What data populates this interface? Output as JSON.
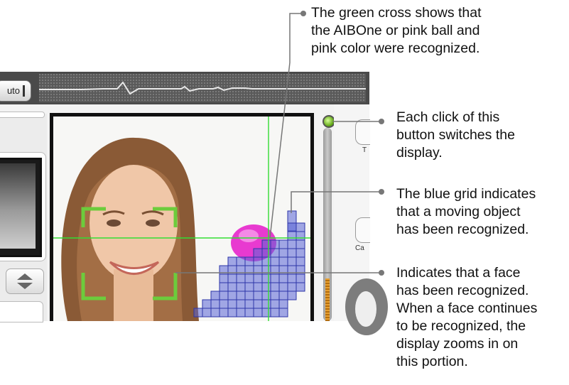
{
  "toolbar": {
    "auto_label": "uto"
  },
  "right_panel": {
    "tab_top_label": "T",
    "tab_mid_label": "Ca"
  },
  "annotations": {
    "green_cross": [
      "The green cross shows that",
      "the AIBOne or pink ball and",
      "pink color were recognized."
    ],
    "display_button": [
      "Each click of this",
      "button switches the",
      "display."
    ],
    "blue_grid": [
      "The blue grid indicates",
      "that a moving object",
      "has been recognized."
    ],
    "face": [
      "Indicates that a face",
      "has been recognized.",
      "When a face continues",
      "to be recognized, the",
      "display zooms in on",
      "this portion."
    ]
  },
  "colors": {
    "face_frame": "#6ccc3c",
    "cross_line": "#33dd33",
    "grid_cell": "#5a64d6",
    "ball": "#e83ad0",
    "callout_line": "#777777"
  },
  "icons": {
    "display_toggle": "green-dot-button",
    "scroll_button": "up-down-arrow-icon"
  }
}
